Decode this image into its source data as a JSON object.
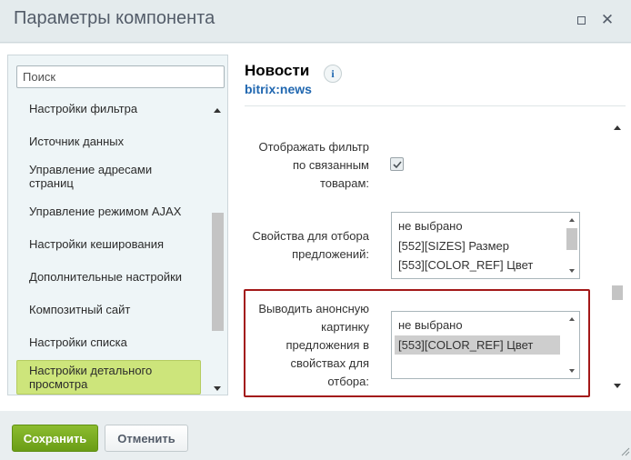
{
  "window": {
    "title": "Параметры компонента",
    "maximize_icon": "maximize-icon",
    "close_icon": "close-icon",
    "close_glyph": "✕"
  },
  "sidebar": {
    "search_placeholder": "Поиск",
    "items": [
      {
        "label": "Настройки фильтра"
      },
      {
        "label": "Источник данных"
      },
      {
        "label": "Управление адресами страниц"
      },
      {
        "label": "Управление режимом AJAX"
      },
      {
        "label": "Настройки кеширования"
      },
      {
        "label": "Дополнительные настройки"
      },
      {
        "label": "Композитный сайт"
      },
      {
        "label": "Настройки списка"
      },
      {
        "label": "Настройки детального просмотра",
        "active": true
      }
    ]
  },
  "component": {
    "name": "Новости",
    "code": "bitrix:news",
    "info_glyph": "i"
  },
  "params": {
    "filter_label": "Отображать фильтр по связанным товарам:",
    "filter_checked": true,
    "offer_props_label": "Свойства для отбора предложений:",
    "offer_props_options": [
      "не выбрано",
      "[552][SIZES] Размер",
      "[553][COLOR_REF] Цвет"
    ],
    "preview_label": "Выводить анонсную картинку предложения в свойствах для отбора:",
    "preview_options": [
      "не выбрано",
      "[553][COLOR_REF] Цвет"
    ],
    "preview_selected": "[553][COLOR_REF] Цвет"
  },
  "colors": {
    "save_button": "#79aa1f",
    "link_blue": "#2067b0",
    "highlight_border": "#a31818",
    "active_nav": "#cde57b"
  },
  "footer": {
    "save_label": "Сохранить",
    "cancel_label": "Отменить"
  }
}
